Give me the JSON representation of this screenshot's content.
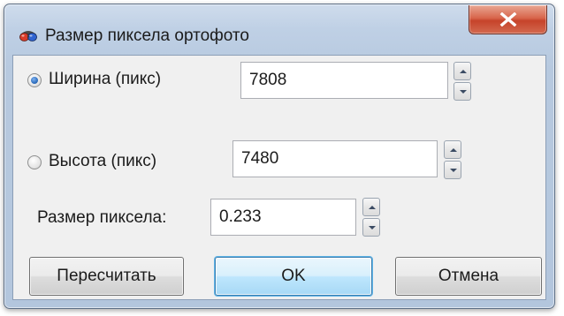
{
  "window": {
    "title": "Размер пиксела ортофото",
    "app_icon": "red-blue-3d-glasses-icon",
    "close_icon": "close-x-icon"
  },
  "width_row": {
    "label": "Ширина (пикс)",
    "value": "7808",
    "selected": true
  },
  "height_row": {
    "label": "Высота (пикс)",
    "value": "7480",
    "selected": false
  },
  "pixel_size": {
    "label": "Размер пиксела:",
    "value": "0.233"
  },
  "buttons": {
    "recalculate": "Пересчитать",
    "ok": "OK",
    "cancel": "Отмена"
  },
  "colors": {
    "close_button": "#c6432a",
    "default_button_border": "#3c7fb1",
    "radio_selected": "#2f6fbf"
  }
}
